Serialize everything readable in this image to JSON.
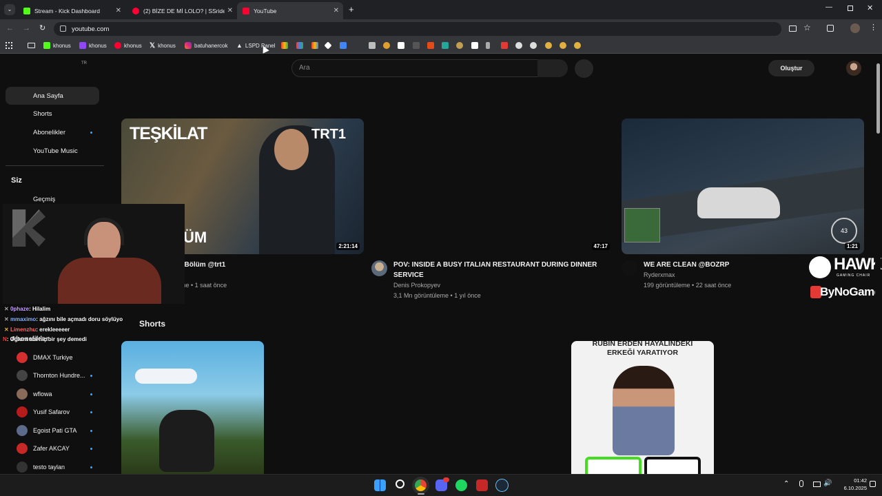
{
  "browser": {
    "tabs": [
      {
        "title": "Stream - Kick Dashboard",
        "favicon_color": "#53fc18"
      },
      {
        "title": "(2) BİZE DE Mİ LOLO? | SSriders",
        "favicon_color": "#ff0033"
      },
      {
        "title": "YouTube",
        "favicon_color": "#ff0033",
        "active": true
      }
    ],
    "url": "youtube.com",
    "bookmarks": [
      {
        "label": "khonus",
        "icon": "kick-icon",
        "color": "#53fc18"
      },
      {
        "label": "khonus",
        "icon": "twitch-icon",
        "color": "#9146ff"
      },
      {
        "label": "khonus",
        "icon": "youtube-icon",
        "color": "#ff0033"
      },
      {
        "label": "khonus",
        "icon": "x-icon",
        "color": "#ffffff"
      },
      {
        "label": "batuhanercok",
        "icon": "instagram-icon",
        "color": "#e1306c"
      },
      {
        "label": "LSPD Panel",
        "icon": "lspd-icon",
        "color": "#ffffff"
      }
    ]
  },
  "youtube": {
    "country_code": "TR",
    "search_placeholder": "Ara",
    "create_label": "Oluştur",
    "nav": [
      {
        "label": "Ana Sayfa",
        "active": true
      },
      {
        "label": "Shorts"
      },
      {
        "label": "Abonelikler",
        "dot": true
      },
      {
        "label": "YouTube Music"
      }
    ],
    "you_heading": "Siz",
    "history_label": "Geçmiş",
    "subscriptions_heading": "Abonelikler",
    "subscriptions": [
      {
        "name": "DMAX Turkiye",
        "color": "#d32f2f",
        "dot": false
      },
      {
        "name": "Thornton Hundre...",
        "color": "#444444",
        "dot": true
      },
      {
        "name": "wflowa",
        "color": "#8a6a5a",
        "dot": true
      },
      {
        "name": "Yusif Safarov",
        "color": "#b71c1c",
        "dot": true
      },
      {
        "name": "Egoist Pati GTA",
        "color": "#5c6b8a",
        "dot": true
      },
      {
        "name": "Zafer AKCAY",
        "color": "#c62828",
        "dot": true
      },
      {
        "name": "testo taylan",
        "color": "#333333",
        "dot": true
      }
    ],
    "videos": [
      {
        "title": ". Bölüm @trt1",
        "meta": "me • 1 saat önce",
        "channel": "",
        "duration": "2:21:14",
        "thumb_text_left": "TEŞKİLAT",
        "thumb_text_right": "TRT1",
        "thumb_text_bottom": "ÜM"
      },
      {
        "title": "POV: INSIDE A BUSY ITALIAN RESTAURANT DURING DINNER SERVICE",
        "channel": "Denis Prokopyev",
        "meta": "3,1 Mn görüntüleme • 1 yıl önce",
        "duration": "47:17"
      },
      {
        "title": "WE ARE CLEAN @BOZRP",
        "channel": "Ryderxmax",
        "meta": "199 görüntüleme • 22 saat önce",
        "duration": "1:21"
      }
    ],
    "shorts_heading": "Shorts",
    "short_caption": "RÜBİN ERDEN HAYALİNDEKİ ERKEĞİ YARATIYOR"
  },
  "overlay": {
    "sponsor1": "HAWK",
    "sponsor1_sub": "GAMING CHAIR",
    "sponsor2": "ByNoGame",
    "chat": [
      {
        "user": "0phaze",
        "text": "Hilalim",
        "color": "#c8a2ff"
      },
      {
        "user": "mmaximo",
        "text": "ağzını bile açmadı doru söylüyo",
        "color": "#8ab4f8"
      },
      {
        "user": "Limenzhu",
        "text": "erekleeeeer",
        "color": "#ff6b6b"
      },
      {
        "user": "N",
        "text": "Oğlum abi hiç bir şey demedi",
        "color": "#ff3b3b"
      }
    ]
  },
  "taskbar": {
    "time": "01:42",
    "date": "6.10.2025"
  }
}
